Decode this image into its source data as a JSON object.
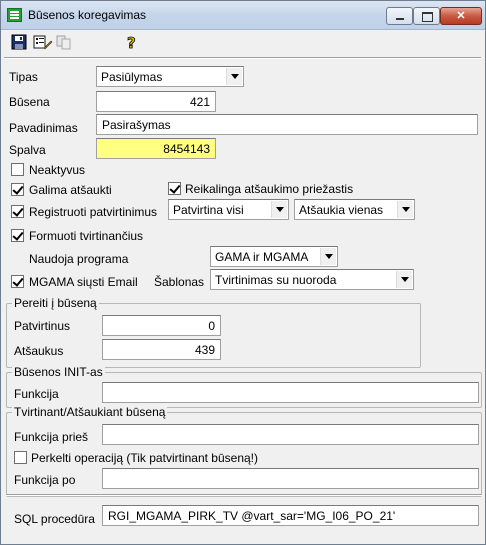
{
  "window": {
    "title": "Būsenos koregavimas",
    "controls": {
      "close_symbol": "✕"
    }
  },
  "toolbar": {
    "icons": [
      "save-icon",
      "form-edit-icon",
      "copy-icon",
      "help-icon"
    ],
    "help_symbol": "?"
  },
  "form": {
    "tipas": {
      "label": "Tipas",
      "value": "Pasiūlymas"
    },
    "busena": {
      "label": "Būsena",
      "value": "421"
    },
    "pavadinimas": {
      "label": "Pavadinimas",
      "value": "Pasirašymas"
    },
    "spalva": {
      "label": "Spalva",
      "value": "8454143",
      "highlight_color": "#ffff80"
    },
    "neaktyvus": {
      "label": "Neaktyvus",
      "checked": false
    },
    "galima_atsaukti": {
      "label": "Galima atšaukti",
      "checked": true
    },
    "reikalinga_priezastis": {
      "label": "Reikalinga atšaukimo priežastis",
      "checked": true
    },
    "registruoti": {
      "label": "Registruoti patvirtinimus",
      "checked": true
    },
    "patvirtina_combo": {
      "value": "Patvirtina visi"
    },
    "atsaukia_combo": {
      "value": "Atšaukia vienas"
    },
    "formuoti": {
      "label": "Formuoti tvirtinančius",
      "checked": true
    },
    "naudoja_programa": {
      "label": "Naudoja programa",
      "value": "GAMA ir MGAMA"
    },
    "mgama_email": {
      "label": "MGAMA siųsti Email",
      "checked": true
    },
    "sablonas": {
      "label": "Šablonas",
      "value": "Tvirtinimas su nuoroda"
    }
  },
  "pereiti": {
    "title": "Pereiti į būseną",
    "patvirtinus": {
      "label": "Patvirtinus",
      "value": "0"
    },
    "atsaukus": {
      "label": "Atšaukus",
      "value": "439"
    }
  },
  "init": {
    "title": "Būsenos INIT-as",
    "funkcija": {
      "label": "Funkcija",
      "value": ""
    }
  },
  "tvirtinant": {
    "title": "Tvirtinant/Atšaukiant būseną",
    "funkcija_pries": {
      "label": "Funkcija prieš",
      "value": ""
    },
    "perkelti": {
      "label": "Perkelti operaciją (Tik patvirtinant būseną!)",
      "checked": false
    },
    "funkcija_po": {
      "label": "Funkcija po",
      "value": ""
    }
  },
  "sql": {
    "label": "SQL procedūra",
    "value": "RGI_MGAMA_PIRK_TV @vart_sar='MG_I06_PO_21'"
  }
}
